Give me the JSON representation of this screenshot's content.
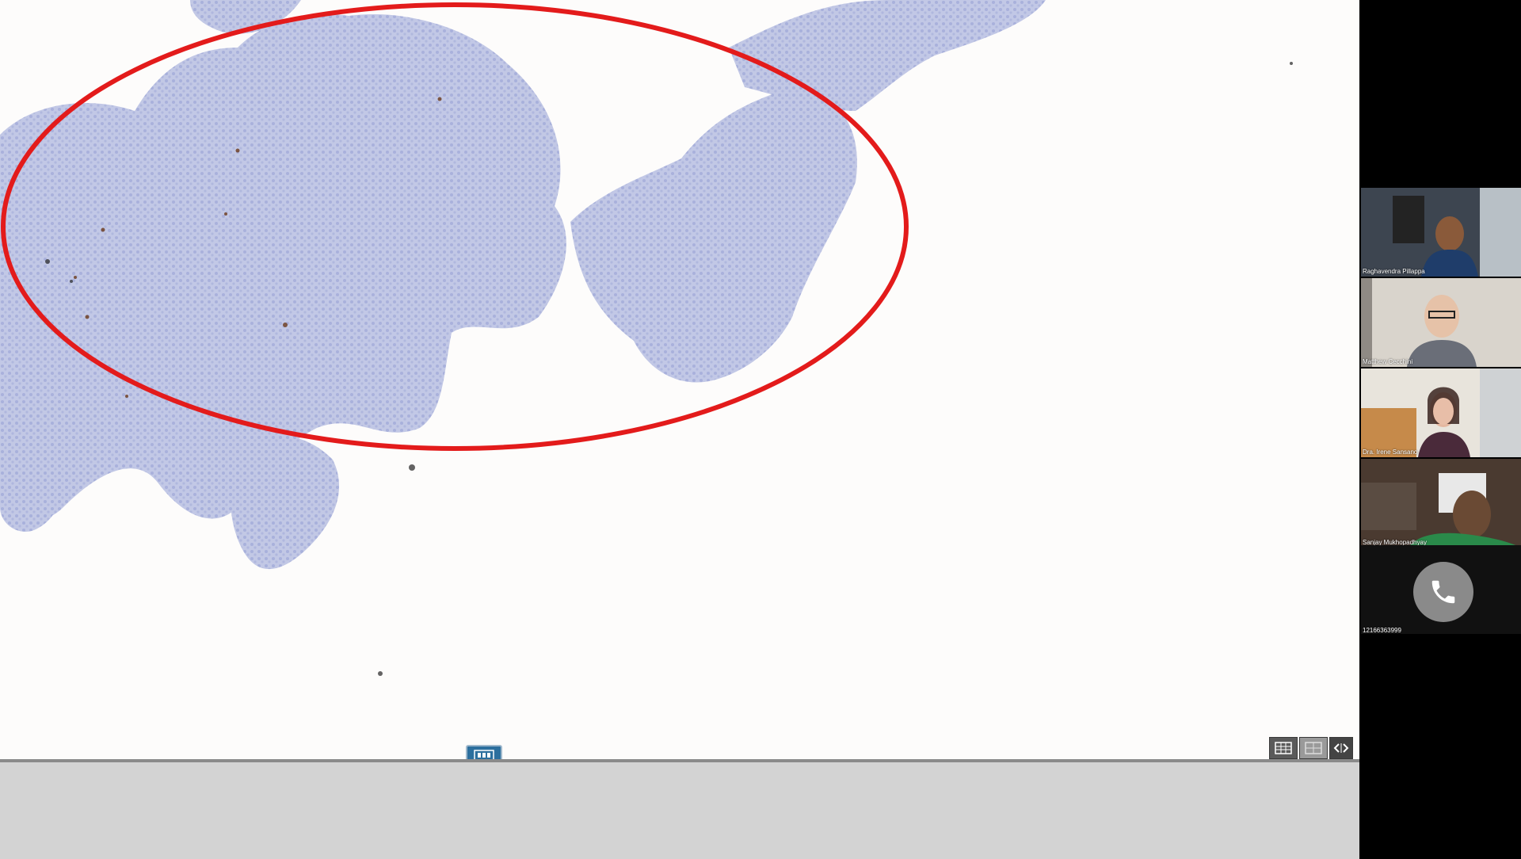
{
  "viewer": {
    "annotation": "red-ellipse",
    "tray_tab_icon": "film-strip-icon",
    "view_controls": [
      {
        "icon": "grid-view-icon"
      },
      {
        "icon": "split-view-icon"
      },
      {
        "icon": "prev-next-icon"
      }
    ]
  },
  "participants": [
    {
      "name": "Raghavendra Pillappa"
    },
    {
      "name": "Matthew Cecchini"
    },
    {
      "name": "Dra. Irene Sansano"
    },
    {
      "name": "Sanjay Mukhopadhyay"
    }
  ],
  "phone_participant": {
    "name": "12166363999",
    "icon": "phone-icon"
  },
  "colors": {
    "annotation": "#e31b1b",
    "tissue": "#a9b3dc",
    "sidebar": "#000000",
    "bottom_bar": "#d3d3d3"
  }
}
